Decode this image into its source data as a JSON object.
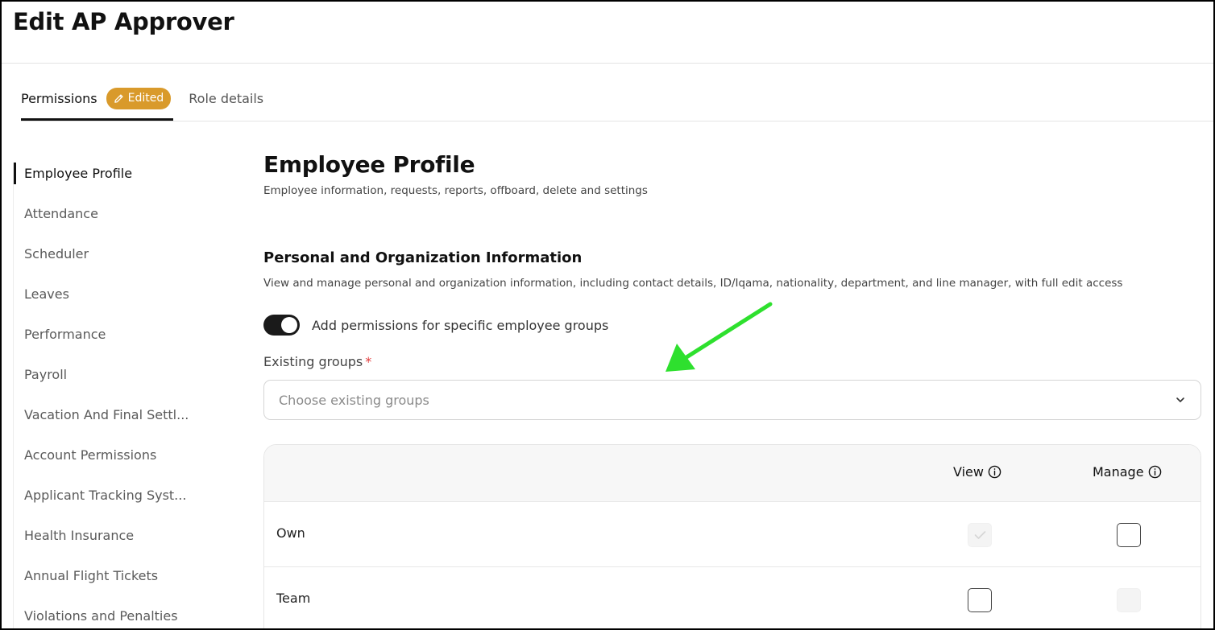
{
  "header": {
    "title": "Edit AP Approver"
  },
  "tabs": [
    {
      "label": "Permissions",
      "badge": "Edited",
      "active": true
    },
    {
      "label": "Role details",
      "active": false
    }
  ],
  "sidebar": {
    "items": [
      {
        "label": "Employee Profile",
        "active": true
      },
      {
        "label": "Attendance"
      },
      {
        "label": "Scheduler"
      },
      {
        "label": "Leaves"
      },
      {
        "label": "Performance"
      },
      {
        "label": "Payroll"
      },
      {
        "label": "Vacation And Final Settl..."
      },
      {
        "label": "Account Permissions"
      },
      {
        "label": "Applicant Tracking Syst..."
      },
      {
        "label": "Health Insurance"
      },
      {
        "label": "Annual Flight Tickets"
      },
      {
        "label": "Violations and Penalties"
      }
    ]
  },
  "main": {
    "title": "Employee Profile",
    "description": "Employee information, requests, reports, offboard, delete and settings",
    "section": {
      "title": "Personal and Organization Information",
      "description": "View and manage personal and organization information, including contact details, ID/Iqama, nationality, department, and line manager, with full edit access"
    },
    "toggle": {
      "label": "Add permissions for specific employee groups",
      "on": true
    },
    "groups_field": {
      "label": "Existing groups",
      "required_mark": "*",
      "placeholder": "Choose existing groups"
    },
    "table": {
      "columns": [
        "View",
        "Manage"
      ],
      "rows": [
        {
          "label": "Own",
          "view": "checked-disabled",
          "manage": "unchecked"
        },
        {
          "label": "Team",
          "view": "unchecked",
          "manage": "disabled"
        }
      ]
    }
  },
  "colors": {
    "badge": "#d99a2b",
    "toggle_on": "#1a1a1a",
    "required": "#e23b3b",
    "annotation_arrow": "#2ee02e"
  },
  "icons": {
    "badge": "pencil-icon",
    "select": "chevron-down-icon",
    "column_header": "info-icon",
    "checked": "check-icon",
    "annotation": "green-arrow-icon"
  }
}
